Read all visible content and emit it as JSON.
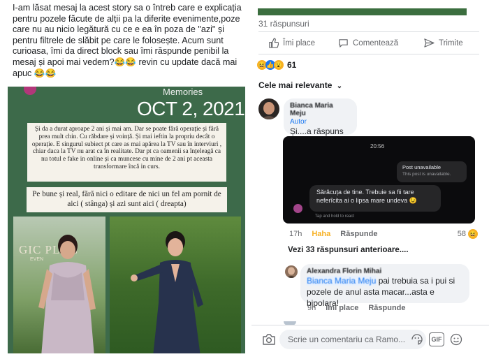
{
  "left": {
    "caption": "I-am lăsat mesaj la acest story sa o întreb care e explicația pentru pozele făcute de alții pa la diferite evenimente,poze care nu au nicio legătură cu ce e ea în poza de \"azi\" și pentru filtrele de slăbit pe care le folosește. Acum sunt curioasa, îmi da direct block sau îmi răspunde penibil la mesaj și apoi mai vedem?😂😂 revin cu update dacă mai apuc 😂😂",
    "story": {
      "memories": "Memories",
      "date": "OCT 2, 2021",
      "note1": "Și da a durat aproape 2 ani și mai am. Dar se poate fără operație și fără prea mult chin. Cu răbdare și voință. Și mai ieftin la propriu decât o operație. E singurul subiect pt care as mai apărea la TV sau în interviuri , chiar daca la TV nu arat ca în realitate. Dar pt ca oamenii sa înțeleagă ca nu totul e fake in online și ca muncese cu mine de 2 ani pt aceasta transformare încă in curs.",
      "note2": "Pe bune și real, fără nici o editare de nici un fel am pornit de aici ( stânga) și azi sunt aici ( dreapta)",
      "venue": "GIC PLAC",
      "venue_sub": "EVEN"
    }
  },
  "right": {
    "replies_count": "31 răspunsuri",
    "actions": {
      "like": "Îmi place",
      "comment": "Comentează",
      "share": "Trimite"
    },
    "reactions_count": "61",
    "sort_label": "Cele mai relevante",
    "comment1": {
      "name": "Bianca Maria Meju",
      "badge": "Autor",
      "text": "Și....a răspuns",
      "time": "17h",
      "reaction": "Haha",
      "reply": "Răspunde",
      "react_count": "58"
    },
    "dm": {
      "time": "20:56",
      "unavailable_title": "Post unavailable",
      "unavailable_sub": "This post is unavailable.",
      "message": "Sărăcuța de tine. Trebuie sa fii tare neferîcita  ai o lipsa mare undeva 😉",
      "tap_hint": "Tap and hold to react"
    },
    "see_more": "Vezi 33 răspunsuri anterioare....",
    "comment2": {
      "name": "Alexandra Florin Mihai",
      "tag": "Bianca Maria Meju",
      "text": " pai trebuia sa i pui si pozele de anul asta macar...asta e bipolara!",
      "time": "9h",
      "like": "Îmi place",
      "reply": "Răspunde"
    },
    "composer": {
      "placeholder": "Scrie un comentariu ca Ramo...",
      "gif": "GIF"
    },
    "colors": {
      "accent": "#1877f2",
      "haha": "#f7b125",
      "story_bg": "#3d6a4a"
    }
  }
}
